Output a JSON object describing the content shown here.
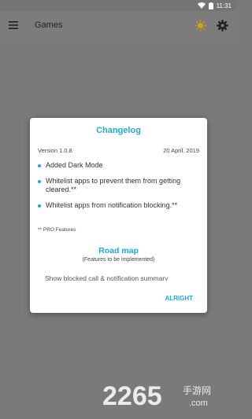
{
  "status_bar": {
    "time": "11:31"
  },
  "app_bar": {
    "title": "Games"
  },
  "dialog": {
    "title": "Changelog",
    "version": "Version 1.0.8",
    "date": "20 April, 2019",
    "changes": [
      "Added Dark Mode",
      "Whitelist apps to prevent them from getting cleared.**",
      "Whitelist apps from notification blocking.**"
    ],
    "pro_note": "** PRO Features",
    "roadmap_title": "Road map",
    "roadmap_subtitle": "(Features to be implemented)",
    "roadmap_item_partial": "Show blocked call & notification summary",
    "confirm_label": "ALRIGHT"
  },
  "watermark": {
    "text": "2265",
    "sub": "手游网",
    "domain": ".com"
  },
  "colors": {
    "accent": "#1eaad8",
    "scrim": "#7a7a7a"
  }
}
